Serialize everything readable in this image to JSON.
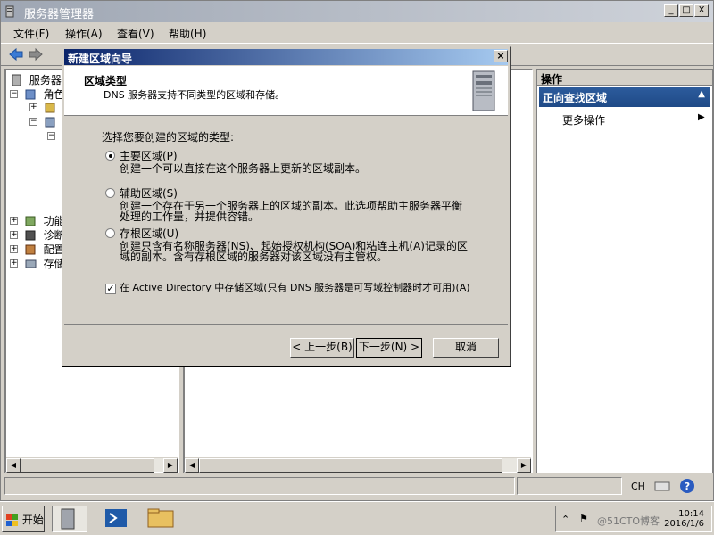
{
  "window": {
    "title": "服务器管理器",
    "controls": {
      "minimize": "_",
      "maximize": "□",
      "close": "X"
    }
  },
  "menu": {
    "items": [
      "文件(F)",
      "操作(A)",
      "查看(V)",
      "帮助(H)"
    ]
  },
  "tree": {
    "root": "服务器管",
    "roles": "角色",
    "features": "功能",
    "diagnostics": "诊断",
    "configuration": "配置",
    "storage": "存储"
  },
  "actions": {
    "header": "操作",
    "section": "正向查找区域",
    "more": "更多操作"
  },
  "dialog": {
    "title": "新建区域向导",
    "header_title": "区域类型",
    "header_desc": "DNS 服务器支持不同类型的区域和存储。",
    "prompt": "选择您要创建的区域的类型:",
    "options": [
      {
        "label": "主要区域(P)",
        "desc": "创建一个可以直接在这个服务器上更新的区域副本。",
        "selected": true
      },
      {
        "label": "辅助区域(S)",
        "desc": "创建一个存在于另一个服务器上的区域的副本。此选项帮助主服务器平衡处理的工作量，并提供容错。",
        "selected": false
      },
      {
        "label": "存根区域(U)",
        "desc": "创建只含有名称服务器(NS)、起始授权机构(SOA)和粘连主机(A)记录的区域的副本。含有存根区域的服务器对该区域没有主管权。",
        "selected": false
      }
    ],
    "ad_checkbox": {
      "label": "在 Active Directory 中存储区域(只有 DNS 服务器是可写域控制器时才可用)(A)",
      "checked": true
    },
    "buttons": {
      "back": "< 上一步(B)",
      "next": "下一步(N) >",
      "cancel": "取消"
    }
  },
  "statusbar": {
    "lang": "CH"
  },
  "taskbar": {
    "start": "开始",
    "clock_time": "10:14",
    "clock_date": "2016/1/6",
    "watermark": "@51CTO博客"
  }
}
